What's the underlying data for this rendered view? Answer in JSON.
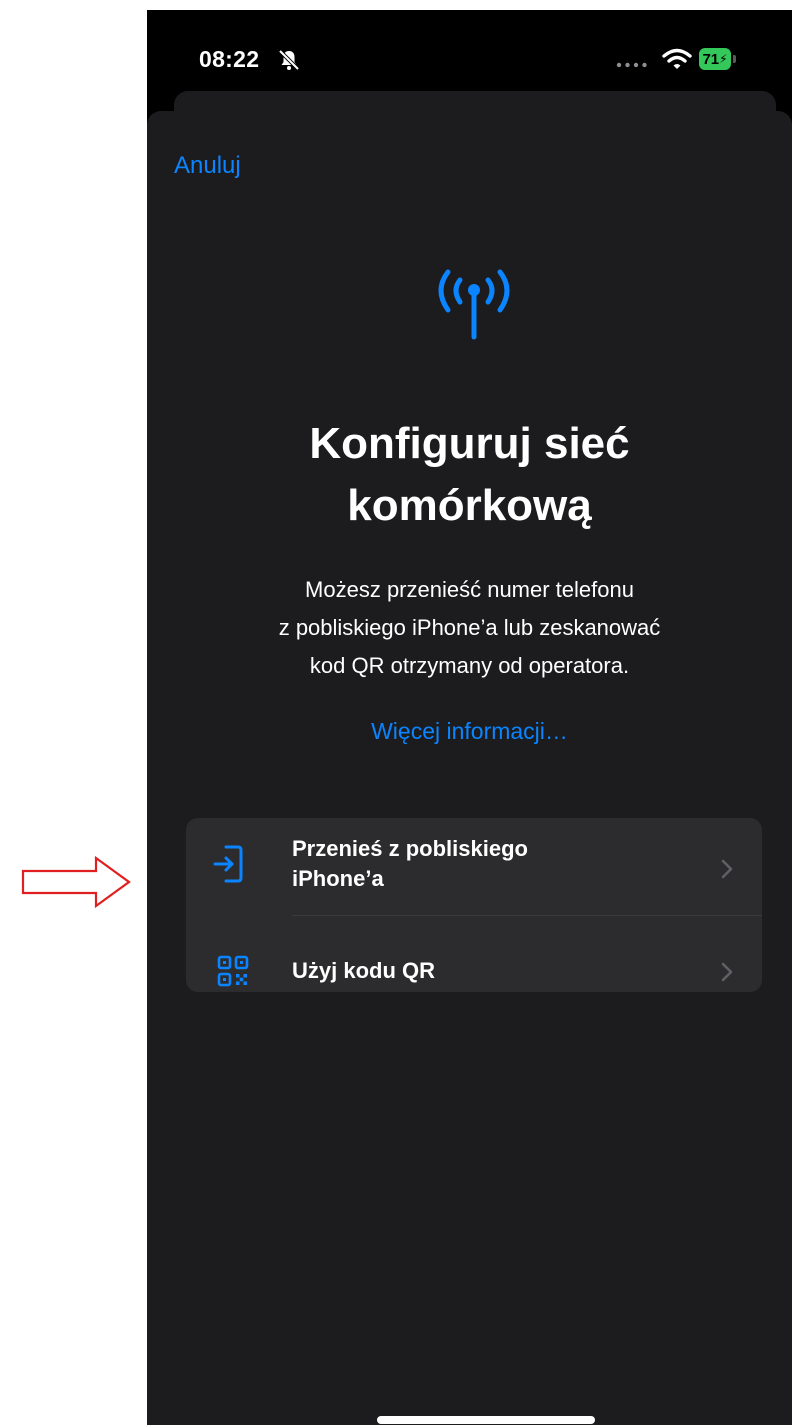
{
  "status_bar": {
    "time": "08:22",
    "battery_level": "71",
    "icons": [
      "bell-slash-icon",
      "signal-dots-icon",
      "wifi-icon",
      "battery-charging-icon"
    ]
  },
  "sheet": {
    "cancel_label": "Anuluj",
    "header_icon": "antenna-radiowaves-icon",
    "title_line1": "Konfiguruj sieć",
    "title_line2": "komórkową",
    "description_lines": [
      "Możesz przenieść numer telefonu",
      "z pobliskiego iPhone’a lub zeskanować",
      "kod QR otrzymany od operatora."
    ],
    "more_info_link": "Więcej informacji…",
    "options": [
      {
        "label_line1": "Przenieś z pobliskiego",
        "label_line2": "iPhone’a",
        "icon": "transfer-in-icon"
      },
      {
        "label": "Użyj kodu QR",
        "icon": "qr-code-icon"
      }
    ]
  },
  "annotation": {
    "icon": "arrow-right-outline-icon",
    "color": "#e02020"
  },
  "colors": {
    "accent": "#0a84ff",
    "sheet_background": "#1c1c1e",
    "option_background": "#2c2c2e",
    "battery_green": "#34c759"
  }
}
